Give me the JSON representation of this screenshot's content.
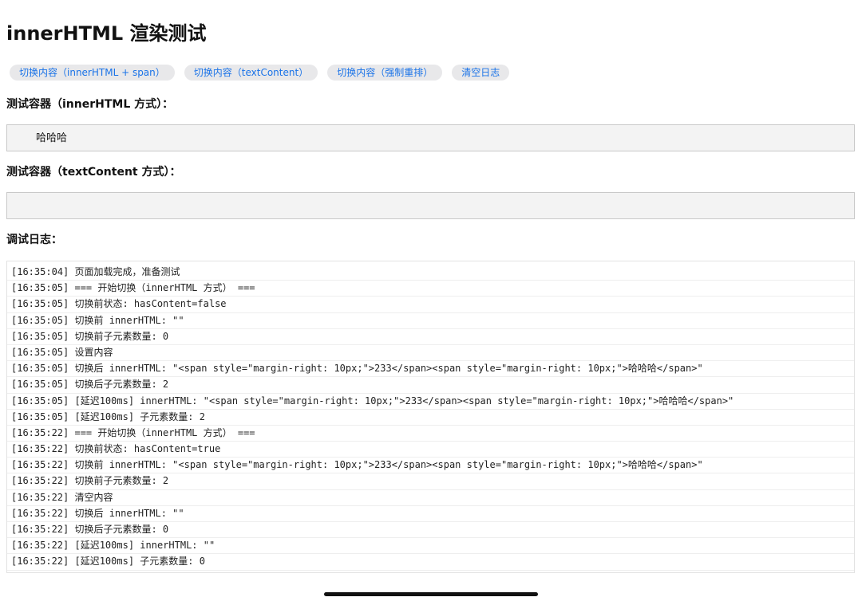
{
  "title": "innerHTML 渲染测试",
  "buttons": [
    {
      "label": "切换内容（innerHTML + span）"
    },
    {
      "label": "切换内容（textContent）"
    },
    {
      "label": "切换内容（强制重排）"
    },
    {
      "label": "清空日志"
    }
  ],
  "container1": {
    "label": "测试容器（innerHTML 方式）：",
    "content": "哈哈哈"
  },
  "container2": {
    "label": "测试容器（textContent 方式）：",
    "content": ""
  },
  "log": {
    "label": "调试日志：",
    "lines": [
      "[16:35:04] 页面加载完成，准备测试",
      "[16:35:05] === 开始切换（innerHTML 方式） ===",
      "[16:35:05] 切换前状态: hasContent=false",
      "[16:35:05] 切换前 innerHTML: \"\"",
      "[16:35:05] 切换前子元素数量: 0",
      "[16:35:05] 设置内容",
      "[16:35:05] 切换后 innerHTML: \"<span style=\"margin-right: 10px;\">233</span><span style=\"margin-right: 10px;\">哈哈哈</span>\"",
      "[16:35:05] 切换后子元素数量: 2",
      "[16:35:05] [延迟100ms] innerHTML: \"<span style=\"margin-right: 10px;\">233</span><span style=\"margin-right: 10px;\">哈哈哈</span>\"",
      "[16:35:05] [延迟100ms] 子元素数量: 2",
      "[16:35:22] === 开始切换（innerHTML 方式） ===",
      "[16:35:22] 切换前状态: hasContent=true",
      "[16:35:22] 切换前 innerHTML: \"<span style=\"margin-right: 10px;\">233</span><span style=\"margin-right: 10px;\">哈哈哈</span>\"",
      "[16:35:22] 切换前子元素数量: 2",
      "[16:35:22] 清空内容",
      "[16:35:22] 切换后 innerHTML: \"\"",
      "[16:35:22] 切换后子元素数量: 0",
      "[16:35:22] [延迟100ms] innerHTML: \"\"",
      "[16:35:22] [延迟100ms] 子元素数量: 0"
    ]
  }
}
